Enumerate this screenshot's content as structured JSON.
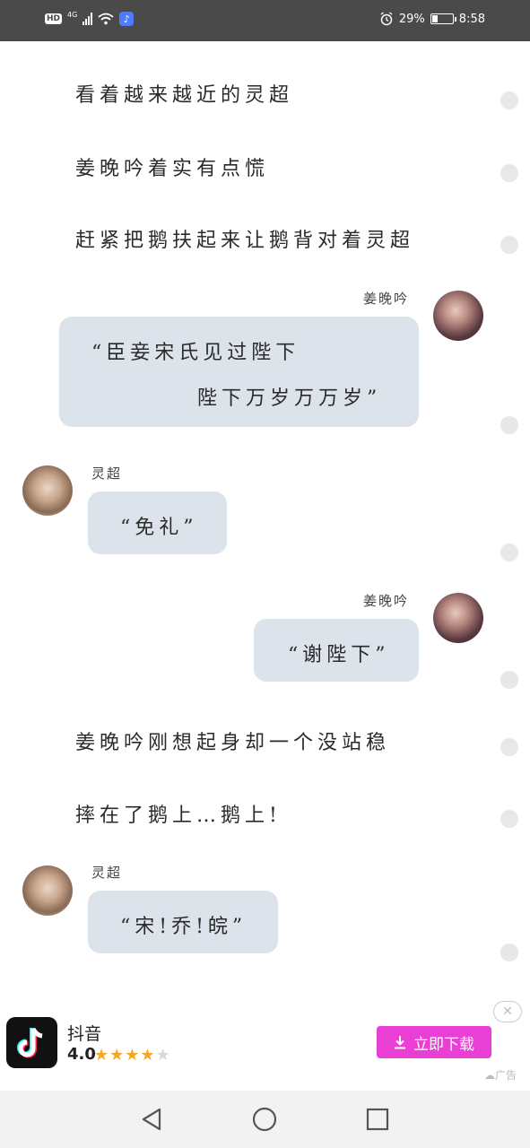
{
  "status_bar": {
    "hd": "HD",
    "network": "4G",
    "battery_percent": "29%",
    "battery_level": 0.29,
    "time": "8:58",
    "icons": [
      "signal-icon",
      "wifi-icon",
      "music-app-icon",
      "alarm-icon",
      "battery-icon"
    ]
  },
  "story": {
    "lines": [
      "看着越来越近的灵超",
      "姜晚吟着实有点慌",
      "赶紧把鹅扶起来让鹅背对着灵超",
      "姜晚吟刚想起身却一个没站稳",
      "摔在了鹅上…鹅上!"
    ]
  },
  "chat": {
    "messages": [
      {
        "sender": "姜晚吟",
        "side": "right",
        "lines": [
          "“臣妾宋氏见过陛下",
          "陛下万岁万万岁”"
        ]
      },
      {
        "sender": "灵超",
        "side": "left",
        "lines": [
          "“免礼”"
        ]
      },
      {
        "sender": "姜晚吟",
        "side": "right",
        "lines": [
          "“谢陛下”"
        ]
      },
      {
        "sender": "灵超",
        "side": "left",
        "lines": [
          "“宋!乔!皖”"
        ]
      }
    ]
  },
  "ad": {
    "app_name": "抖音",
    "rating": "4.0",
    "stars": 4,
    "stars_total": 5,
    "button_label": "立即下载",
    "tag": "广告",
    "close": "✕",
    "colors": {
      "button": "#e93fd4",
      "star": "#f5a623"
    }
  },
  "navbar": {
    "icons": [
      "back-icon",
      "home-icon",
      "recents-icon"
    ]
  }
}
